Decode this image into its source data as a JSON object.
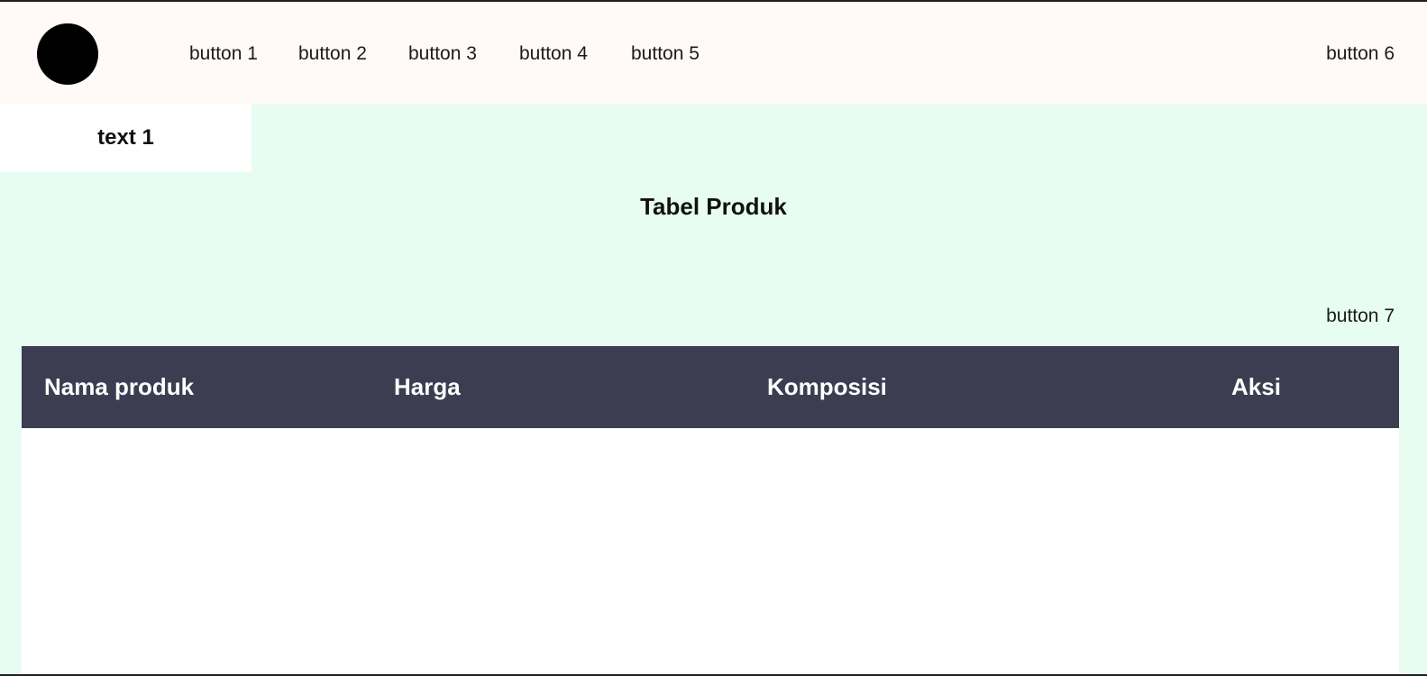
{
  "navbar": {
    "buttons": [
      "button 1",
      "button 2",
      "button 3",
      "button 4",
      "button 5"
    ],
    "right_button": "button 6"
  },
  "sidebar": {
    "active_label": "text 1"
  },
  "main": {
    "title": "Tabel Produk",
    "action_button": "button 7",
    "table": {
      "columns": [
        "Nama produk",
        "Harga",
        "Komposisi",
        "Aksi"
      ],
      "rows": []
    }
  },
  "colors": {
    "background": "#e8fdf2",
    "navbar": "#fff9f7",
    "table_header": "#3d3d52"
  }
}
